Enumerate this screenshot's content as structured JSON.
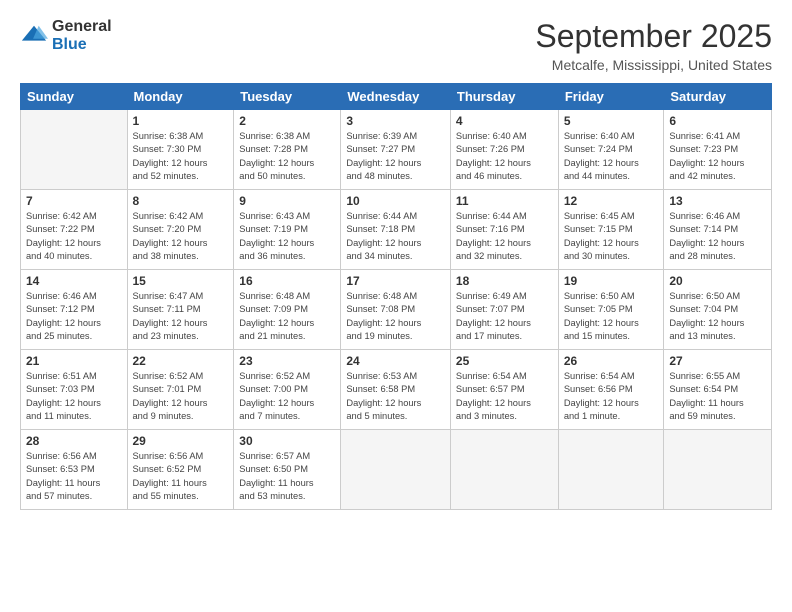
{
  "logo": {
    "line1": "General",
    "line2": "Blue"
  },
  "title": "September 2025",
  "location": "Metcalfe, Mississippi, United States",
  "days_of_week": [
    "Sunday",
    "Monday",
    "Tuesday",
    "Wednesday",
    "Thursday",
    "Friday",
    "Saturday"
  ],
  "weeks": [
    [
      {
        "day": "",
        "info": ""
      },
      {
        "day": "1",
        "info": "Sunrise: 6:38 AM\nSunset: 7:30 PM\nDaylight: 12 hours\nand 52 minutes."
      },
      {
        "day": "2",
        "info": "Sunrise: 6:38 AM\nSunset: 7:28 PM\nDaylight: 12 hours\nand 50 minutes."
      },
      {
        "day": "3",
        "info": "Sunrise: 6:39 AM\nSunset: 7:27 PM\nDaylight: 12 hours\nand 48 minutes."
      },
      {
        "day": "4",
        "info": "Sunrise: 6:40 AM\nSunset: 7:26 PM\nDaylight: 12 hours\nand 46 minutes."
      },
      {
        "day": "5",
        "info": "Sunrise: 6:40 AM\nSunset: 7:24 PM\nDaylight: 12 hours\nand 44 minutes."
      },
      {
        "day": "6",
        "info": "Sunrise: 6:41 AM\nSunset: 7:23 PM\nDaylight: 12 hours\nand 42 minutes."
      }
    ],
    [
      {
        "day": "7",
        "info": "Sunrise: 6:42 AM\nSunset: 7:22 PM\nDaylight: 12 hours\nand 40 minutes."
      },
      {
        "day": "8",
        "info": "Sunrise: 6:42 AM\nSunset: 7:20 PM\nDaylight: 12 hours\nand 38 minutes."
      },
      {
        "day": "9",
        "info": "Sunrise: 6:43 AM\nSunset: 7:19 PM\nDaylight: 12 hours\nand 36 minutes."
      },
      {
        "day": "10",
        "info": "Sunrise: 6:44 AM\nSunset: 7:18 PM\nDaylight: 12 hours\nand 34 minutes."
      },
      {
        "day": "11",
        "info": "Sunrise: 6:44 AM\nSunset: 7:16 PM\nDaylight: 12 hours\nand 32 minutes."
      },
      {
        "day": "12",
        "info": "Sunrise: 6:45 AM\nSunset: 7:15 PM\nDaylight: 12 hours\nand 30 minutes."
      },
      {
        "day": "13",
        "info": "Sunrise: 6:46 AM\nSunset: 7:14 PM\nDaylight: 12 hours\nand 28 minutes."
      }
    ],
    [
      {
        "day": "14",
        "info": "Sunrise: 6:46 AM\nSunset: 7:12 PM\nDaylight: 12 hours\nand 25 minutes."
      },
      {
        "day": "15",
        "info": "Sunrise: 6:47 AM\nSunset: 7:11 PM\nDaylight: 12 hours\nand 23 minutes."
      },
      {
        "day": "16",
        "info": "Sunrise: 6:48 AM\nSunset: 7:09 PM\nDaylight: 12 hours\nand 21 minutes."
      },
      {
        "day": "17",
        "info": "Sunrise: 6:48 AM\nSunset: 7:08 PM\nDaylight: 12 hours\nand 19 minutes."
      },
      {
        "day": "18",
        "info": "Sunrise: 6:49 AM\nSunset: 7:07 PM\nDaylight: 12 hours\nand 17 minutes."
      },
      {
        "day": "19",
        "info": "Sunrise: 6:50 AM\nSunset: 7:05 PM\nDaylight: 12 hours\nand 15 minutes."
      },
      {
        "day": "20",
        "info": "Sunrise: 6:50 AM\nSunset: 7:04 PM\nDaylight: 12 hours\nand 13 minutes."
      }
    ],
    [
      {
        "day": "21",
        "info": "Sunrise: 6:51 AM\nSunset: 7:03 PM\nDaylight: 12 hours\nand 11 minutes."
      },
      {
        "day": "22",
        "info": "Sunrise: 6:52 AM\nSunset: 7:01 PM\nDaylight: 12 hours\nand 9 minutes."
      },
      {
        "day": "23",
        "info": "Sunrise: 6:52 AM\nSunset: 7:00 PM\nDaylight: 12 hours\nand 7 minutes."
      },
      {
        "day": "24",
        "info": "Sunrise: 6:53 AM\nSunset: 6:58 PM\nDaylight: 12 hours\nand 5 minutes."
      },
      {
        "day": "25",
        "info": "Sunrise: 6:54 AM\nSunset: 6:57 PM\nDaylight: 12 hours\nand 3 minutes."
      },
      {
        "day": "26",
        "info": "Sunrise: 6:54 AM\nSunset: 6:56 PM\nDaylight: 12 hours\nand 1 minute."
      },
      {
        "day": "27",
        "info": "Sunrise: 6:55 AM\nSunset: 6:54 PM\nDaylight: 11 hours\nand 59 minutes."
      }
    ],
    [
      {
        "day": "28",
        "info": "Sunrise: 6:56 AM\nSunset: 6:53 PM\nDaylight: 11 hours\nand 57 minutes."
      },
      {
        "day": "29",
        "info": "Sunrise: 6:56 AM\nSunset: 6:52 PM\nDaylight: 11 hours\nand 55 minutes."
      },
      {
        "day": "30",
        "info": "Sunrise: 6:57 AM\nSunset: 6:50 PM\nDaylight: 11 hours\nand 53 minutes."
      },
      {
        "day": "",
        "info": ""
      },
      {
        "day": "",
        "info": ""
      },
      {
        "day": "",
        "info": ""
      },
      {
        "day": "",
        "info": ""
      }
    ]
  ]
}
